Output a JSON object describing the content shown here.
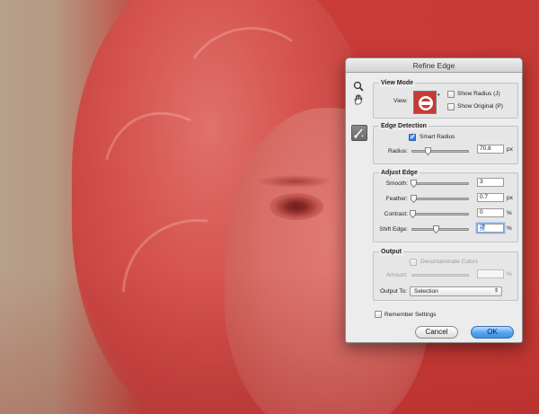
{
  "dialog": {
    "title": "Refine Edge",
    "tools": {
      "zoom": "zoom-icon",
      "hand": "hand-icon",
      "refine_brush": "refine-radius-brush-icon"
    },
    "view_mode": {
      "section_label": "View Mode",
      "view_label": "View:",
      "show_radius": {
        "label": "Show Radius (J)",
        "checked": false
      },
      "show_original": {
        "label": "Show Original (P)",
        "checked": false
      }
    },
    "edge_detection": {
      "section_label": "Edge Detection",
      "smart_radius": {
        "label": "Smart Radius",
        "checked": true
      },
      "radius": {
        "label": "Radius:",
        "value": "70.8",
        "unit": "px",
        "slider_fraction": 0.28
      }
    },
    "adjust_edge": {
      "section_label": "Adjust Edge",
      "smooth": {
        "label": "Smooth:",
        "value": "3",
        "unit": "",
        "slider_fraction": 0.03
      },
      "feather": {
        "label": "Feather:",
        "value": "0.7",
        "unit": "px",
        "slider_fraction": 0.03
      },
      "contrast": {
        "label": "Contrast:",
        "value": "0",
        "unit": "%",
        "slider_fraction": 0.0
      },
      "shift_edge": {
        "label": "Shift Edge:",
        "value": "-7",
        "unit": "%",
        "slider_fraction": 0.43
      }
    },
    "output": {
      "section_label": "Output",
      "decontaminate": {
        "label": "Decontaminate Colors",
        "checked": false
      },
      "amount": {
        "label": "Amount:",
        "value": "",
        "unit": "%"
      },
      "output_to": {
        "label": "Output To:",
        "selected": "Selection"
      }
    },
    "remember_settings": {
      "label": "Remember Settings",
      "checked": false
    },
    "buttons": {
      "cancel": "Cancel",
      "ok": "OK"
    }
  },
  "colors": {
    "overlay_red": "#c73a36",
    "ok_blue": "#3d8fe6",
    "dialog_bg": "#ececec"
  }
}
